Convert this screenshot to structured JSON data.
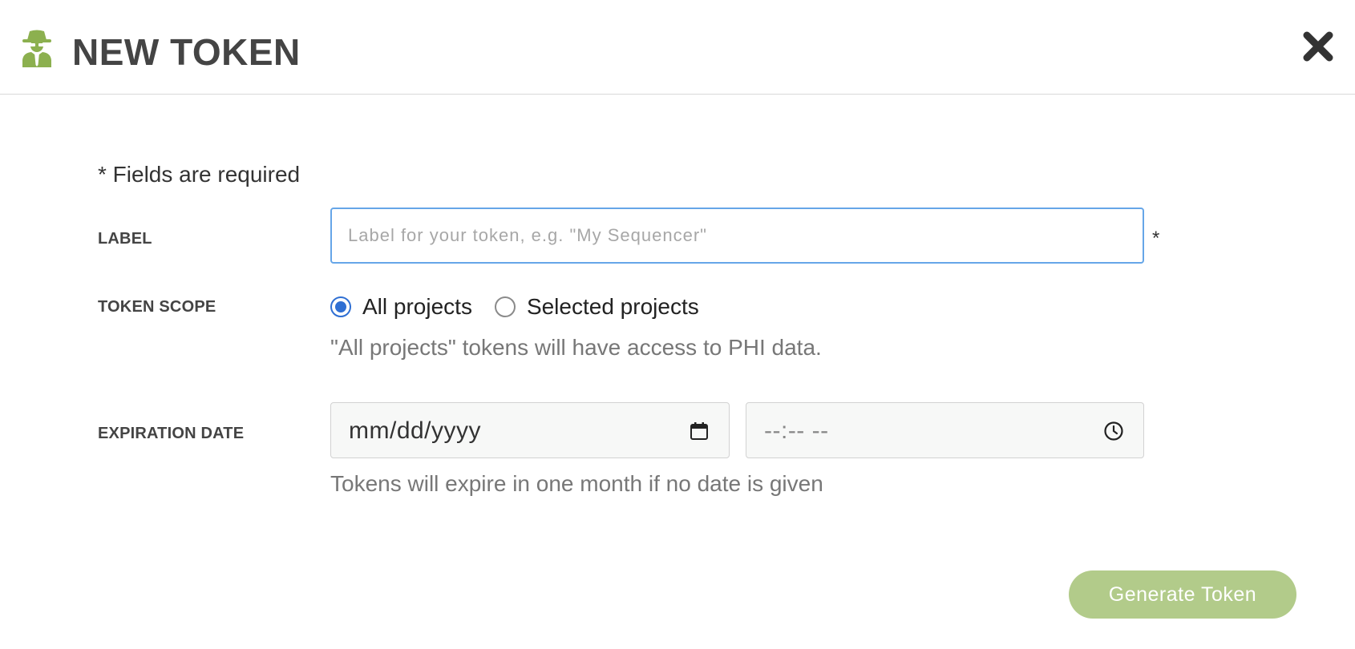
{
  "header": {
    "title": "NEW TOKEN",
    "icon": "spy-icon",
    "close_icon": "close-icon",
    "accent_color": "#8cb04f"
  },
  "form": {
    "required_note": "* Fields are required",
    "label": {
      "label": "LABEL",
      "value": "",
      "placeholder": "Label for your token, e.g. \"My Sequencer\"",
      "required_marker": "*"
    },
    "token_scope": {
      "label": "TOKEN SCOPE",
      "options": [
        {
          "label": "All projects",
          "selected": true
        },
        {
          "label": "Selected projects",
          "selected": false
        }
      ],
      "hint": "\"All projects\" tokens will have access to PHI data."
    },
    "expiration": {
      "label": "EXPIRATION DATE",
      "date_placeholder": "mm/dd/yyyy",
      "time_placeholder": "--:-- --",
      "date_icon": "calendar-icon",
      "time_icon": "clock-icon",
      "hint": "Tokens will expire in one month if no date is given"
    }
  },
  "actions": {
    "generate_label": "Generate Token",
    "generate_color": "#b2cb8a"
  }
}
